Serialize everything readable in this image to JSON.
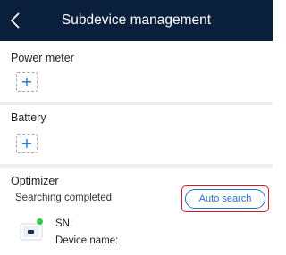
{
  "header": {
    "title": "Subdevice management",
    "back_icon": "chevron-left-icon"
  },
  "sections": {
    "power_meter": {
      "label": "Power meter",
      "add_symbol": "+"
    },
    "battery": {
      "label": "Battery",
      "add_symbol": "+"
    },
    "optimizer": {
      "label": "Optimizer",
      "status": "Searching completed",
      "auto_search_label": "Auto search",
      "device": {
        "sn_label": "SN:",
        "device_name_label": "Device name:"
      }
    }
  },
  "colors": {
    "header_bg": "#0a1f3c",
    "accent": "#2a6fd0",
    "highlight": "#d21e2a",
    "online": "#2ecc40"
  }
}
